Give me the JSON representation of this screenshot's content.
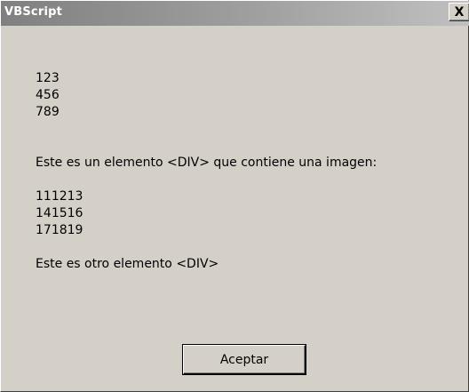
{
  "window": {
    "title": "VBScript",
    "close_glyph": "X"
  },
  "message": {
    "lines": [
      "123",
      "456",
      "789",
      "",
      "",
      "Este es un elemento <DIV> que contiene una imagen:",
      "",
      "111213",
      "141516",
      "171819",
      "",
      "Este es otro elemento <DIV>"
    ]
  },
  "buttons": {
    "ok_label": "Aceptar"
  }
}
